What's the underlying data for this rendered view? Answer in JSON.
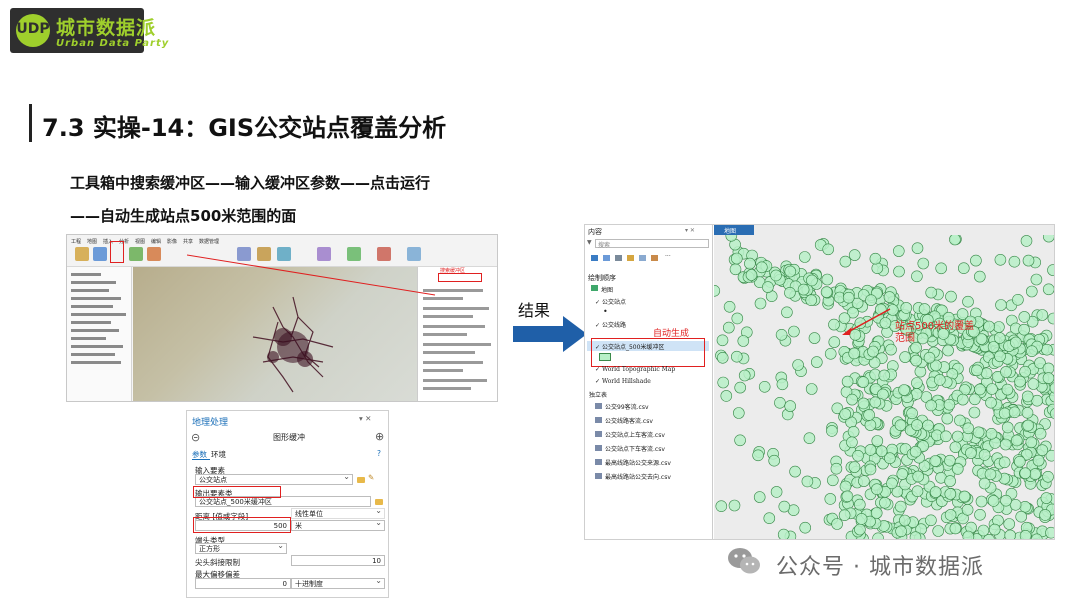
{
  "logo": {
    "mark": "UDP",
    "cn": "城市数据派",
    "en": "Urban Data Party"
  },
  "slide": {
    "title": "7.3 实操-14：GIS公交站点覆盖分析",
    "subtitle_line1": "工具箱中搜索缓冲区——输入缓冲区参数——点击运行",
    "subtitle_line2": "——自动生成站点500米范围的面"
  },
  "arcgis_left": {
    "tabs": [
      "工程",
      "地图",
      "插入",
      "分析",
      "视图",
      "编辑",
      "影像",
      "共享",
      "数据管理"
    ],
    "gp_label": "搜索缓冲区",
    "search_value": "缓冲区"
  },
  "geoprocessing": {
    "panel_title": "地理处理",
    "tool_title": "图形缓冲",
    "tabs": [
      "参数",
      "环境"
    ],
    "input_label": "输入要素",
    "input_value": "公交站点",
    "output_label": "输出要素类",
    "output_value": "公交站点_500米缓冲区",
    "distance_label": "距离 [值或字段]",
    "distance_value": "500",
    "distance_unit": "米",
    "unit_type": "线性单位",
    "buffer_type_label": "端头类型",
    "buffer_type_value": "正方形",
    "miter_label": "尖头斜接限制",
    "miter_value": "10",
    "max_offset_label": "最大偏移偏差",
    "max_offset_value": "0",
    "max_offset_unit": "十进制度"
  },
  "result_label": "结果",
  "contents": {
    "title": "内容",
    "search_placeholder": "搜索",
    "draw_order_label": "绘制顺序",
    "map_label": "地图",
    "layers": [
      "公交站点",
      "公交线路",
      "公交站点_500米缓冲区",
      "World Topographic Map",
      "World Hillshade"
    ],
    "standalone_label": "独立表",
    "tables": [
      "公交99客流.csv",
      "公交线路客流.csv",
      "公交站点上车客流.csv",
      "公交站点下车客流.csv",
      "最高线路站公交来源.csv",
      "最高线路站公交去向.csv"
    ],
    "auto_generated": "自动生成",
    "map_tab": "地图"
  },
  "map_annotation": "站点500米的覆盖范围",
  "footer": {
    "text": "公众号 · 城市数据派"
  },
  "colors": {
    "accent_red": "#e02020",
    "buffer_fill": "#b8f0c8",
    "buffer_stroke": "#3a8a4a",
    "logo_green": "#9fcf2c"
  }
}
